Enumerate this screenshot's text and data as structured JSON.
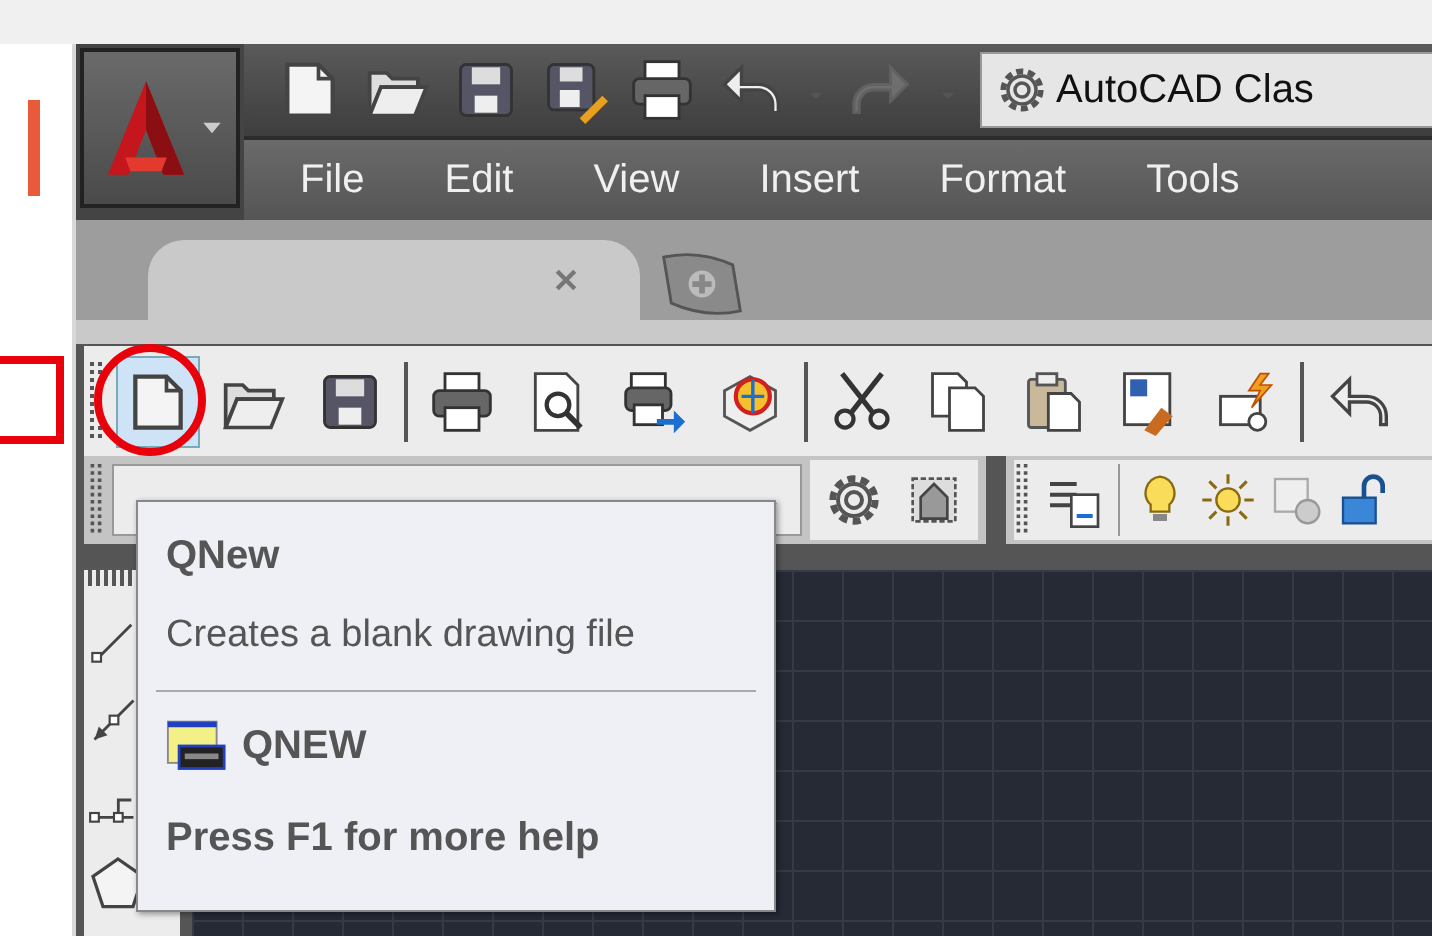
{
  "quick_access": {
    "workspace": "AutoCAD Clas",
    "redo_disabled": true
  },
  "menu_bar": {
    "items": [
      {
        "label": "File"
      },
      {
        "label": "Edit"
      },
      {
        "label": "View"
      },
      {
        "label": "Insert"
      },
      {
        "label": "Format"
      },
      {
        "label": "Tools"
      }
    ]
  },
  "file_tabs": {
    "tabs": [
      {
        "selected": true
      }
    ]
  },
  "standard_toolbar": {
    "buttons": [
      {
        "highlighted": true
      },
      {
        "highlighted": false
      },
      {
        "highlighted": false
      },
      {
        "highlighted": false
      },
      {
        "highlighted": false
      },
      {
        "highlighted": false
      },
      {
        "highlighted": false
      },
      {
        "highlighted": false
      },
      {
        "highlighted": false
      },
      {
        "highlighted": false
      },
      {
        "highlighted": false
      },
      {
        "highlighted": false
      },
      {
        "highlighted": false
      }
    ]
  },
  "tooltip": {
    "title": "QNew",
    "description": "Creates a blank drawing file",
    "command": "QNEW",
    "help": "Press F1 for more help"
  }
}
